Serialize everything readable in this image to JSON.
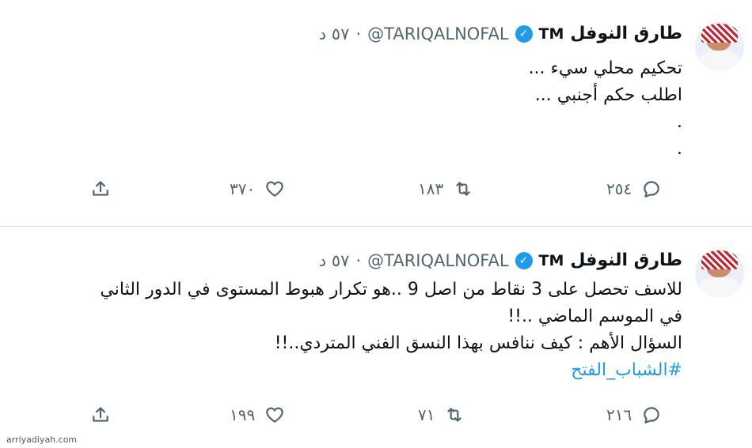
{
  "tweets": [
    {
      "author": {
        "name": "طارق النوفل",
        "badge": "TM",
        "handle": "@TARIQALNOFAL",
        "separator": "·",
        "time": "٥٧ د"
      },
      "lines": [
        "تحكيم محلي سيء ...",
        "اطلب حكم أجنبي ...",
        ".",
        "."
      ],
      "hashtag": "",
      "actions": {
        "replies": "٢٥٤",
        "retweets": "١٨٣",
        "likes": "٣٧٠"
      }
    },
    {
      "author": {
        "name": "طارق النوفل",
        "badge": "TM",
        "handle": "@TARIQALNOFAL",
        "separator": "·",
        "time": "٥٧ د"
      },
      "lines": [
        "للاسف تحصل على  3 نقاط من اصل 9 ..هو تكرار هبوط المستوى في الدور الثاني",
        "في الموسم الماضي  ..!!",
        "السؤال الأهم : كيف ننافس بهذا النسق الفني المتردي..!!"
      ],
      "hashtag": "#الشباب_الفتح",
      "actions": {
        "replies": "٢١٦",
        "retweets": "٧١",
        "likes": "١٩٩"
      }
    }
  ],
  "watermark": "arriyadiyah.com",
  "colors": {
    "accent": "#1d9bf0",
    "muted": "#536471",
    "text": "#0f1419"
  },
  "icons": {
    "reply": "reply-icon",
    "retweet": "retweet-icon",
    "like": "heart-icon",
    "share": "share-icon",
    "verified": "verified-badge-icon"
  }
}
